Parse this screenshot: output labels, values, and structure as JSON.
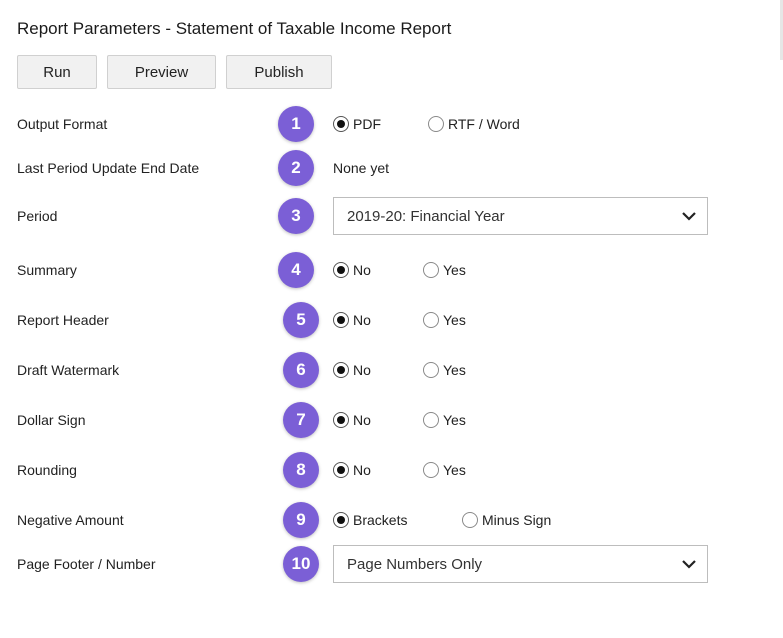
{
  "title": "Report Parameters - Statement of Taxable Income Report",
  "toolbar": {
    "run": "Run",
    "preview": "Preview",
    "publish": "Publish"
  },
  "rows": [
    {
      "label": "Output Format",
      "badge": "1",
      "options": [
        "PDF",
        "RTF / Word"
      ],
      "selected": "PDF"
    },
    {
      "label": "Last Period Update End Date",
      "badge": "2",
      "value": "None yet"
    },
    {
      "label": "Period",
      "badge": "3",
      "select_value": "2019-20: Financial Year"
    },
    {
      "label": "Summary",
      "badge": "4",
      "options": [
        "No",
        "Yes"
      ],
      "selected": "No"
    },
    {
      "label": "Report Header",
      "badge": "5",
      "options": [
        "No",
        "Yes"
      ],
      "selected": "No"
    },
    {
      "label": "Draft Watermark",
      "badge": "6",
      "options": [
        "No",
        "Yes"
      ],
      "selected": "No"
    },
    {
      "label": "Dollar Sign",
      "badge": "7",
      "options": [
        "No",
        "Yes"
      ],
      "selected": "No"
    },
    {
      "label": "Rounding",
      "badge": "8",
      "options": [
        "No",
        "Yes"
      ],
      "selected": "No"
    },
    {
      "label": "Negative Amount",
      "badge": "9",
      "options": [
        "Brackets",
        "Minus Sign"
      ],
      "selected": "Brackets"
    },
    {
      "label": "Page Footer / Number",
      "badge": "10",
      "select_value": "Page Numbers Only"
    }
  ],
  "colors": {
    "badge": "#7b5fd6",
    "button_bg": "#f1f1f1"
  },
  "icons": {
    "dropdown": "chevron-down-icon",
    "radio": "radio-icon"
  }
}
